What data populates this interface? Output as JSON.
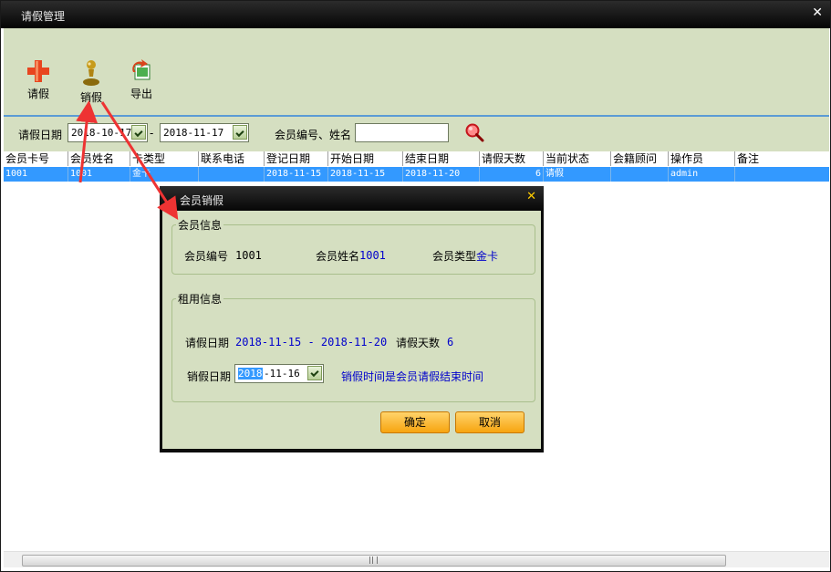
{
  "window": {
    "title": "请假管理"
  },
  "toolbar": {
    "leave_label": "请假",
    "cancel_leave_label": "销假",
    "export_label": "导出"
  },
  "filter": {
    "date_label": "请假日期",
    "date_from": "2018-10-17",
    "dash": "-",
    "date_to": "2018-11-17",
    "member_label": "会员编号、姓名",
    "member_value": ""
  },
  "grid": {
    "columns": [
      "会员卡号",
      "会员姓名",
      "卡类型",
      "联系电话",
      "登记日期",
      "开始日期",
      "结束日期",
      "请假天数",
      "当前状态",
      "会籍顾问",
      "操作员",
      "备注"
    ],
    "rows": [
      {
        "card_no": "1001",
        "name": "1001",
        "card_type": "金卡",
        "phone": "",
        "reg_date": "2018-11-15",
        "start_date": "2018-11-15",
        "end_date": "2018-11-20",
        "days": "6",
        "status": "请假",
        "consultant": "",
        "operator": "admin",
        "remark": ""
      }
    ]
  },
  "dialog": {
    "title": "会员销假",
    "member_group_label": "会员信息",
    "member_no_label": "会员编号",
    "member_no": "1001",
    "member_name_label": "会员姓名",
    "member_name": "1001",
    "member_type_label": "会员类型",
    "member_type": "金卡",
    "rent_group_label": "租用信息",
    "leave_date_label": "请假日期",
    "leave_date_range": "2018-11-15 - 2018-11-20",
    "leave_days_label": "请假天数",
    "leave_days": "6",
    "cancel_date_label": "销假日期",
    "cancel_date_selected": "2018",
    "cancel_date_rest": "-11-16",
    "cancel_note": "销假时间是会员请假结束时间",
    "ok_label": "确定",
    "cancel_label": "取消"
  },
  "colors": {
    "panel": "#d5dfc1",
    "selection": "#3399ff",
    "annotation_arrow": "#ee3333",
    "button": "#f7a40f"
  }
}
